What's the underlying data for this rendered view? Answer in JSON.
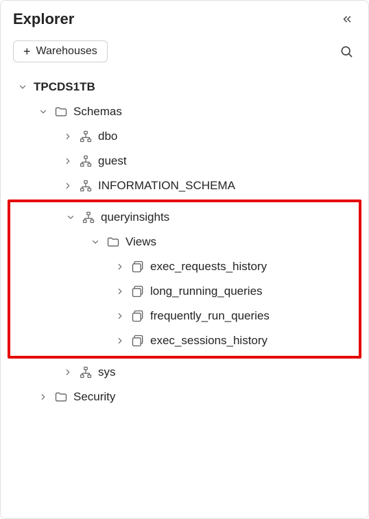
{
  "header": {
    "title": "Explorer"
  },
  "toolbar": {
    "warehouses_label": "Warehouses"
  },
  "tree": {
    "warehouse": "TPCDS1TB",
    "schemas_label": "Schemas",
    "schemas": {
      "dbo": "dbo",
      "guest": "guest",
      "information_schema": "INFORMATION_SCHEMA",
      "queryinsights": "queryinsights",
      "sys": "sys"
    },
    "views_label": "Views",
    "views": {
      "exec_requests_history": "exec_requests_history",
      "long_running_queries": "long_running_queries",
      "frequently_run_queries": "frequently_run_queries",
      "exec_sessions_history": "exec_sessions_history"
    },
    "security_label": "Security"
  }
}
